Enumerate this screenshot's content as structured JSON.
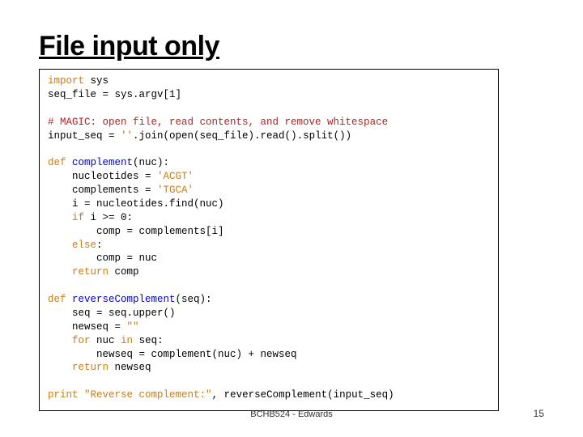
{
  "title": "File input only",
  "code": {
    "l1": {
      "kw": "import",
      "rest": " sys"
    },
    "l2": "seq_file = sys.argv[1]",
    "l3": "# MAGIC: open file, read contents, and remove whitespace",
    "l4a": "input_seq = ",
    "l4b": "''",
    "l4c": ".join(open(seq_file).read().split())",
    "l5": {
      "kw": "def ",
      "fn": "complement",
      "rest": "(nuc):"
    },
    "l6a": "    nucleotides = ",
    "l6b": "'ACGT'",
    "l7a": "    complements = ",
    "l7b": "'TGCA'",
    "l8": "    i = nucleotides.find(nuc)",
    "l9a": "    ",
    "l9kw": "if",
    "l9b": " i >= 0:",
    "l10": "        comp = complements[i]",
    "l11a": "    ",
    "l11kw": "else",
    "l11b": ":",
    "l12": "        comp = nuc",
    "l13a": "    ",
    "l13kw": "return",
    "l13b": " comp",
    "l14": {
      "kw": "def ",
      "fn": "reverseComplement",
      "rest": "(seq):"
    },
    "l15": "    seq = seq.upper()",
    "l16a": "    newseq = ",
    "l16b": "\"\"",
    "l17a": "    ",
    "l17kw": "for",
    "l17b": " nuc ",
    "l17kw2": "in",
    "l17c": " seq:",
    "l18": "        newseq = complement(nuc) + newseq",
    "l19a": "    ",
    "l19kw": "return",
    "l19b": " newseq",
    "l20kw": "print",
    "l20a": " ",
    "l20str": "\"Reverse complement:\"",
    "l20b": ", reverseComplement(input_seq)"
  },
  "footer": "BCHB524 - Edwards",
  "page_number": "15"
}
